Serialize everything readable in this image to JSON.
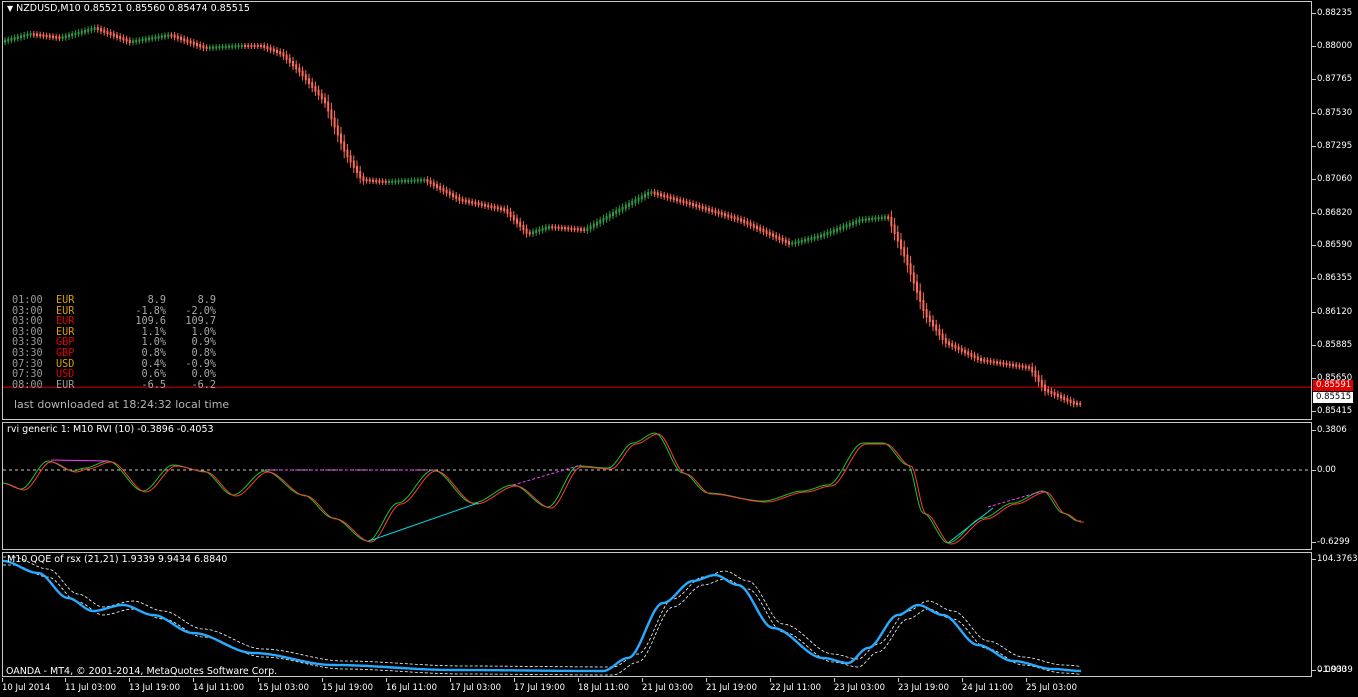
{
  "main_pane": {
    "title": "NZDUSD,M10  0.85521 0.85560 0.85474 0.85515",
    "price_axis": [
      "0.88235",
      "0.88000",
      "0.87765",
      "0.87530",
      "0.87295",
      "0.87060",
      "0.86820",
      "0.86590",
      "0.86355",
      "0.86120",
      "0.85885",
      "0.85650",
      "0.85415"
    ],
    "price_low": 0.85415,
    "price_high": 0.88235,
    "bid_price_label": "0.85515",
    "alert_line_label": "0.85591",
    "alert_line_price": 0.85591,
    "colors": {
      "bull": "#2f9a44",
      "bear": "#ff6a5a",
      "alert_line": "#e00000",
      "badge": "#e00000"
    }
  },
  "news": {
    "rows": [
      {
        "time": "01:00",
        "currency": "EUR",
        "actual": "8.9",
        "forecast": "8.9",
        "color": "#d7a000"
      },
      {
        "time": "03:00",
        "currency": "EUR",
        "actual": "-1.8%",
        "forecast": "-2.0%",
        "color": "#d7a000"
      },
      {
        "time": "03:00",
        "currency": "EUR",
        "actual": "109.6",
        "forecast": "109.7",
        "color": "#e00000"
      },
      {
        "time": "03:00",
        "currency": "EUR",
        "actual": "1.1%",
        "forecast": "1.0%",
        "color": "#d7a000"
      },
      {
        "time": "03:30",
        "currency": "GBP",
        "actual": "1.0%",
        "forecast": "0.9%",
        "color": "#e00000"
      },
      {
        "time": "03:30",
        "currency": "GBP",
        "actual": "0.8%",
        "forecast": "0.8%",
        "color": "#e00000"
      },
      {
        "time": "07:30",
        "currency": "USD",
        "actual": "0.4%",
        "forecast": "-0.9%",
        "color": "#d7a000"
      },
      {
        "time": "07:30",
        "currency": "USD",
        "actual": "0.6%",
        "forecast": "0.0%",
        "color": "#e00000"
      },
      {
        "time": "08:00",
        "currency": "EUR",
        "actual": "-6.5",
        "forecast": "-6.2",
        "color": "#9a9a9a"
      }
    ],
    "download_note": "last downloaded at 18:24:32 local time"
  },
  "rvi_pane": {
    "title": "rvi generic 1: M10 RVI (10) -0.3896 -0.4053",
    "axis": [
      "0.3806",
      "0.00",
      "-0.6299"
    ],
    "max": 0.3806,
    "min": -0.6299,
    "colors": {
      "main": "#ff3b3b",
      "signal": "#1ec81e",
      "trend_up": "#00d8e8",
      "trend_down": "#ff40ff",
      "zero": "#c8c8c8"
    }
  },
  "qqe_pane": {
    "title": "M10 QQE of rsx (21,21) 1.9339 9.9434 6.8840",
    "axis_top": "104.3763",
    "axis_bottom": "0.0000",
    "axis_bottom_overlay": "1.9339",
    "colors": {
      "main": "#28aaff",
      "levels": "#ffffff"
    }
  },
  "xaxis": [
    "10 Jul 2014",
    "11 Jul 03:00",
    "13 Jul 19:00",
    "14 Jul 11:00",
    "15 Jul 03:00",
    "15 Jul 19:00",
    "16 Jul 11:00",
    "17 Jul 03:00",
    "17 Jul 19:00",
    "18 Jul 11:00",
    "21 Jul 03:00",
    "21 Jul 19:00",
    "22 Jul 11:00",
    "23 Jul 03:00",
    "23 Jul 19:00",
    "24 Jul 11:00",
    "25 Jul 03:00"
  ],
  "footer": {
    "copyright": "OANDA - MT4, © 2001-2014, MetaQuotes Software Corp."
  }
}
